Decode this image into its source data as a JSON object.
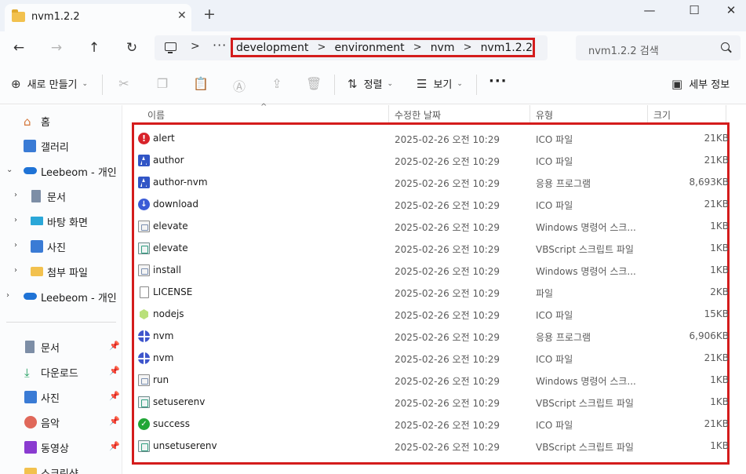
{
  "window": {
    "tab_title": "nvm1.2.2",
    "tab_close": "✕",
    "new_tab": "+",
    "controls": {
      "minimize": "—",
      "maximize": "☐",
      "close": "✕"
    }
  },
  "address": {
    "more": "···",
    "crumbs": [
      "development",
      "environment",
      "nvm",
      "nvm1.2.2"
    ],
    "separator": ">",
    "search_placeholder": "nvm1.2.2 검색"
  },
  "commands": {
    "new": "새로 만들기",
    "sort": "정렬",
    "view": "보기",
    "details": "세부 정보"
  },
  "sidebar": {
    "items": [
      {
        "label": "홈",
        "icon": "home-icon"
      },
      {
        "label": "갤러리",
        "icon": "gallery-icon"
      },
      {
        "label": "Leebeom - 개인",
        "icon": "onedrive-icon"
      },
      {
        "label": "문서",
        "icon": "documents-icon"
      },
      {
        "label": "바탕 화면",
        "icon": "desktop-icon"
      },
      {
        "label": "사진",
        "icon": "pictures-icon"
      },
      {
        "label": "첨부 파일",
        "icon": "folder-icon"
      },
      {
        "label": "Leebeom - 개인",
        "icon": "onedrive-icon"
      }
    ],
    "quick_access": [
      {
        "label": "문서",
        "icon": "documents-icon"
      },
      {
        "label": "다운로드",
        "icon": "downloads-icon"
      },
      {
        "label": "사진",
        "icon": "pictures-icon"
      },
      {
        "label": "음악",
        "icon": "music-icon"
      },
      {
        "label": "동영상",
        "icon": "videos-icon"
      },
      {
        "label": "스크린샷",
        "icon": "folder-icon"
      }
    ]
  },
  "columns": {
    "name": "이름",
    "date": "수정한 날짜",
    "type": "유형",
    "size": "크기"
  },
  "files": [
    {
      "name": "alert",
      "date": "2025-02-26 오전 10:29",
      "type": "ICO 파일",
      "size": "21KB",
      "icon": "alert"
    },
    {
      "name": "author",
      "date": "2025-02-26 오전 10:29",
      "type": "ICO 파일",
      "size": "21KB",
      "icon": "author"
    },
    {
      "name": "author-nvm",
      "date": "2025-02-26 오전 10:29",
      "type": "응용 프로그램",
      "size": "8,693KB",
      "icon": "author"
    },
    {
      "name": "download",
      "date": "2025-02-26 오전 10:29",
      "type": "ICO 파일",
      "size": "21KB",
      "icon": "download"
    },
    {
      "name": "elevate",
      "date": "2025-02-26 오전 10:29",
      "type": "Windows 명령어 스크...",
      "size": "1KB",
      "icon": "script"
    },
    {
      "name": "elevate",
      "date": "2025-02-26 오전 10:29",
      "type": "VBScript 스크립트 파일",
      "size": "1KB",
      "icon": "vbs"
    },
    {
      "name": "install",
      "date": "2025-02-26 오전 10:29",
      "type": "Windows 명령어 스크...",
      "size": "1KB",
      "icon": "script"
    },
    {
      "name": "LICENSE",
      "date": "2025-02-26 오전 10:29",
      "type": "파일",
      "size": "2KB",
      "icon": "doc"
    },
    {
      "name": "nodejs",
      "date": "2025-02-26 오전 10:29",
      "type": "ICO 파일",
      "size": "15KB",
      "icon": "node"
    },
    {
      "name": "nvm",
      "date": "2025-02-26 오전 10:29",
      "type": "응용 프로그램",
      "size": "6,906KB",
      "icon": "nvm"
    },
    {
      "name": "nvm",
      "date": "2025-02-26 오전 10:29",
      "type": "ICO 파일",
      "size": "21KB",
      "icon": "nvm"
    },
    {
      "name": "run",
      "date": "2025-02-26 오전 10:29",
      "type": "Windows 명령어 스크...",
      "size": "1KB",
      "icon": "script"
    },
    {
      "name": "setuserenv",
      "date": "2025-02-26 오전 10:29",
      "type": "VBScript 스크립트 파일",
      "size": "1KB",
      "icon": "vbs"
    },
    {
      "name": "success",
      "date": "2025-02-26 오전 10:29",
      "type": "ICO 파일",
      "size": "21KB",
      "icon": "success"
    },
    {
      "name": "unsetuserenv",
      "date": "2025-02-26 오전 10:29",
      "type": "VBScript 스크립트 파일",
      "size": "1KB",
      "icon": "vbs"
    }
  ]
}
